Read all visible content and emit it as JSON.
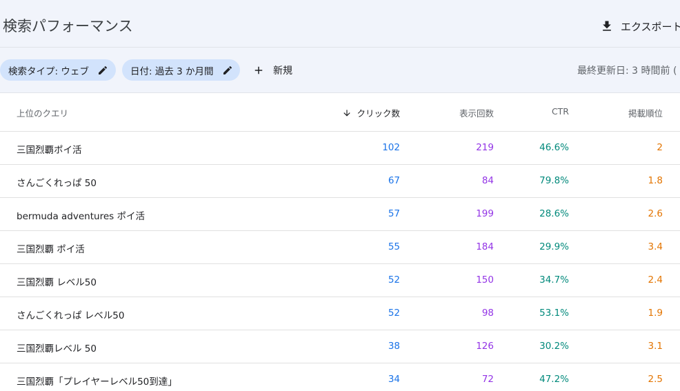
{
  "header": {
    "title": "検索パフォーマンス",
    "export_label": "エクスポート"
  },
  "filters": {
    "search_type_chip": "検索タイプ: ウェブ",
    "date_chip": "日付: 過去 3 か月間",
    "new_label": "新規",
    "last_updated": "最終更新日: 3 時間前 ("
  },
  "table": {
    "columns": {
      "query": "上位のクエリ",
      "clicks": "クリック数",
      "impressions": "表示回数",
      "ctr": "CTR",
      "position": "掲載順位"
    },
    "rows": [
      {
        "query": "三国烈覇ポイ活",
        "clicks": "102",
        "impressions": "219",
        "ctr": "46.6%",
        "position": "2"
      },
      {
        "query": "さんごくれっぱ 50",
        "clicks": "67",
        "impressions": "84",
        "ctr": "79.8%",
        "position": "1.8"
      },
      {
        "query": "bermuda adventures ポイ活",
        "clicks": "57",
        "impressions": "199",
        "ctr": "28.6%",
        "position": "2.6"
      },
      {
        "query": "三国烈覇 ポイ活",
        "clicks": "55",
        "impressions": "184",
        "ctr": "29.9%",
        "position": "3.4"
      },
      {
        "query": "三国烈覇 レベル50",
        "clicks": "52",
        "impressions": "150",
        "ctr": "34.7%",
        "position": "2.4"
      },
      {
        "query": "さんごくれっぱ レベル50",
        "clicks": "52",
        "impressions": "98",
        "ctr": "53.1%",
        "position": "1.9"
      },
      {
        "query": "三国烈覇レベル 50",
        "clicks": "38",
        "impressions": "126",
        "ctr": "30.2%",
        "position": "3.1"
      },
      {
        "query": "三国烈覇「プレイヤーレベル50到達」",
        "clicks": "34",
        "impressions": "72",
        "ctr": "47.2%",
        "position": "2.5"
      }
    ]
  },
  "icons": {
    "export": "download-icon",
    "edit": "pencil-icon",
    "add": "plus-icon",
    "sort": "arrow-down-icon"
  },
  "colors": {
    "clicks": "#1a73e8",
    "impressions": "#9334e6",
    "ctr": "#00897b",
    "position": "#e37400"
  }
}
